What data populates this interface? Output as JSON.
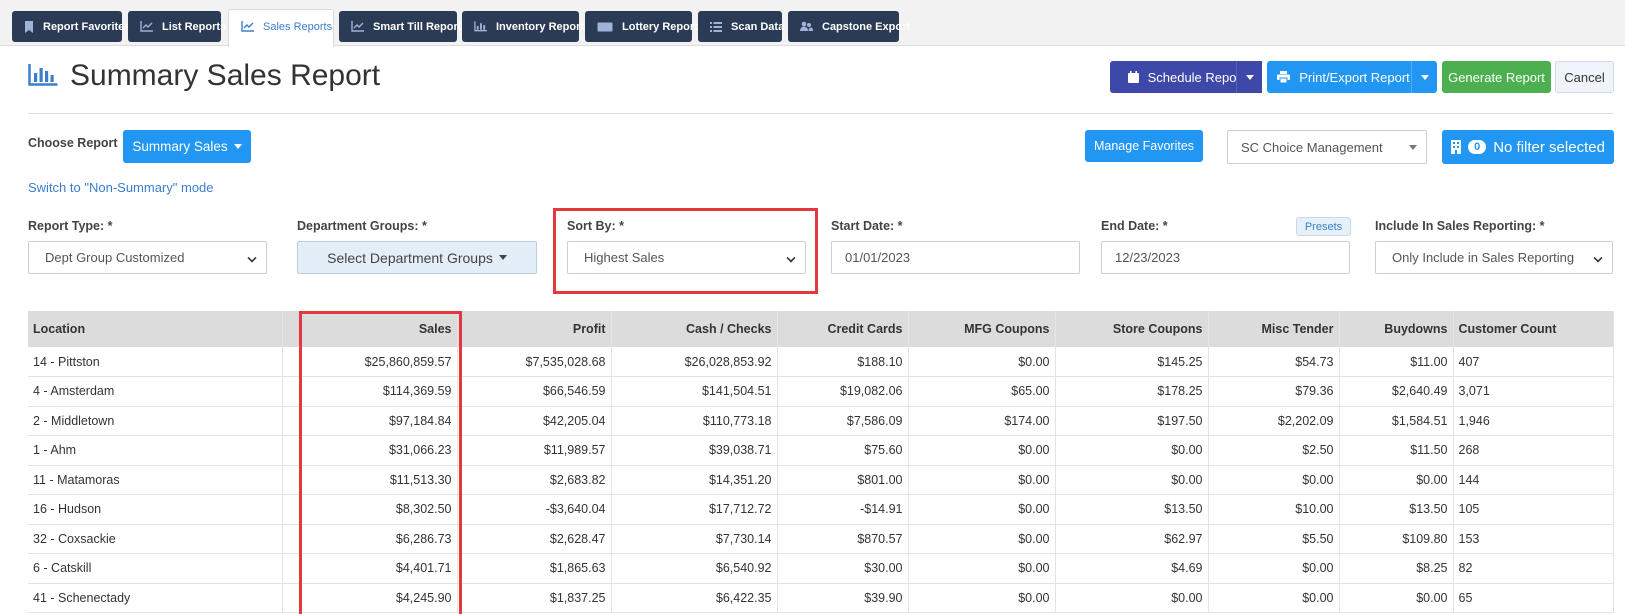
{
  "tabs": [
    {
      "label": "Report Favorites",
      "icon": "bookmark-icon"
    },
    {
      "label": "List Reports",
      "icon": "line-chart-icon"
    },
    {
      "label": "Sales Reports",
      "icon": "line-chart-icon"
    },
    {
      "label": "Smart Till Reports",
      "icon": "line-chart-icon"
    },
    {
      "label": "Inventory Reports",
      "icon": "bar-chart-icon"
    },
    {
      "label": "Lottery Reports",
      "icon": "ticket-icon"
    },
    {
      "label": "Scan Data",
      "icon": "list-icon"
    },
    {
      "label": "Capstone Export",
      "icon": "users-icon"
    }
  ],
  "active_tab": "Sales Reports",
  "page_title": "Summary Sales Report",
  "actions": {
    "schedule": "Schedule Report",
    "print": "Print/Export Report",
    "generate": "Generate Report",
    "cancel": "Cancel"
  },
  "choose_report": {
    "label": "Choose Report",
    "value": "Summary Sales",
    "manage_favorites": "Manage Favorites",
    "company_select": "SC Choice Management",
    "filter_count": "0",
    "filter_label": "No filter selected",
    "mode_link": "Switch to \"Non-Summary\" mode"
  },
  "filters": {
    "report_type_label": "Report Type: *",
    "report_type_value": "Dept Group Customized",
    "dept_groups_label": "Department Groups: *",
    "dept_groups_value": "Select Department Groups",
    "sort_by_label": "Sort By: *",
    "sort_by_value": "Highest Sales",
    "start_date_label": "Start Date: *",
    "start_date_value": "01/01/2023",
    "end_date_label": "End Date: *",
    "end_date_value": "12/23/2023",
    "presets": "Presets",
    "include_label": "Include In Sales Reporting: *",
    "include_value": "Only Include in Sales Reporting"
  },
  "colors": {
    "tab_dark": "#2b3a55",
    "schedule": "#3e48a8",
    "primary": "#2196f3",
    "generate": "#4caf50",
    "highlight": "#e0393e"
  },
  "table": {
    "headers": [
      "Location",
      "Sales",
      "Profit",
      "Cash / Checks",
      "Credit Cards",
      "MFG Coupons",
      "Store Coupons",
      "Misc Tender",
      "Buydowns",
      "Customer Count"
    ],
    "rows": [
      [
        "14 - Pittston",
        "$25,860,859.57",
        "$7,535,028.68",
        "$26,028,853.92",
        "$188.10",
        "$0.00",
        "$145.25",
        "$54.73",
        "$11.00",
        "407"
      ],
      [
        "4 - Amsterdam",
        "$114,369.59",
        "$66,546.59",
        "$141,504.51",
        "$19,082.06",
        "$65.00",
        "$178.25",
        "$79.36",
        "$2,640.49",
        "3,071"
      ],
      [
        "2 - Middletown",
        "$97,184.84",
        "$42,205.04",
        "$110,773.18",
        "$7,586.09",
        "$174.00",
        "$197.50",
        "$2,202.09",
        "$1,584.51",
        "1,946"
      ],
      [
        "1 - Ahm",
        "$31,066.23",
        "$11,989.57",
        "$39,038.71",
        "$75.60",
        "$0.00",
        "$0.00",
        "$2.50",
        "$11.50",
        "268"
      ],
      [
        "11 - Matamoras",
        "$11,513.30",
        "$2,683.82",
        "$14,351.20",
        "$801.00",
        "$0.00",
        "$0.00",
        "$0.00",
        "$0.00",
        "144"
      ],
      [
        "16 - Hudson",
        "$8,302.50",
        "-$3,640.04",
        "$17,712.72",
        "-$14.91",
        "$0.00",
        "$13.50",
        "$10.00",
        "$13.50",
        "105"
      ],
      [
        "32 - Coxsackie",
        "$6,286.73",
        "$2,628.47",
        "$7,730.14",
        "$870.57",
        "$0.00",
        "$62.97",
        "$5.50",
        "$109.80",
        "153"
      ],
      [
        "6 - Catskill",
        "$4,401.71",
        "$1,865.63",
        "$6,540.92",
        "$30.00",
        "$0.00",
        "$4.69",
        "$0.00",
        "$8.25",
        "82"
      ],
      [
        "41 - Schenectady",
        "$4,245.90",
        "$1,837.25",
        "$6,422.35",
        "$39.90",
        "$0.00",
        "$0.00",
        "$0.00",
        "$0.00",
        "65"
      ]
    ]
  }
}
